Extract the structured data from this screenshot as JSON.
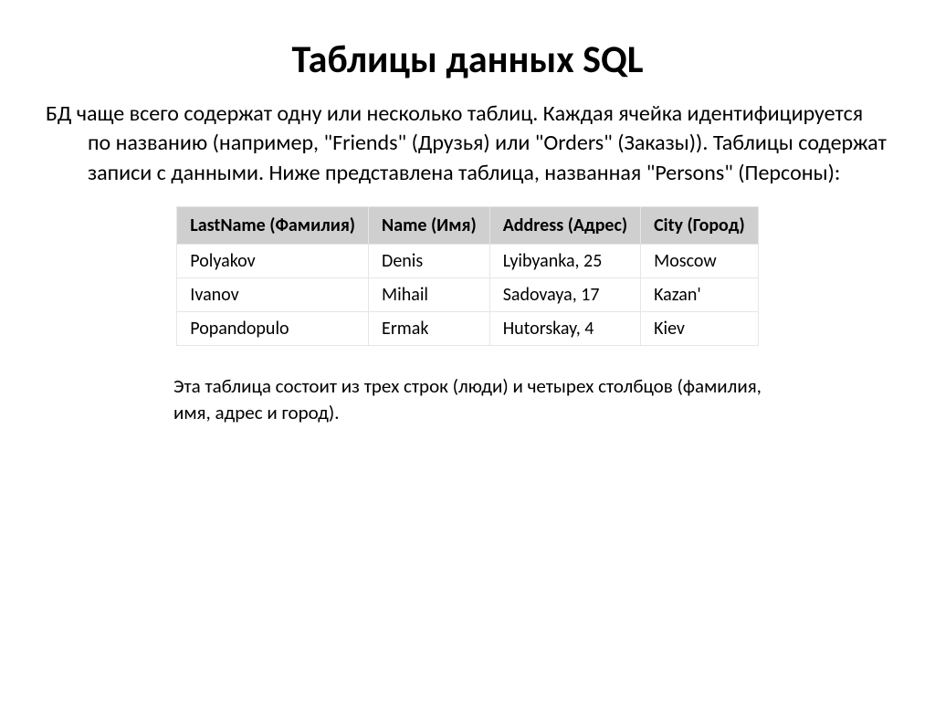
{
  "title": "Таблицы данных SQL",
  "paragraph": "БД чаще всего содержат одну или несколько таблиц. Каждая ячейка идентифицируется по названию (например, \"Friends\" (Друзья) или \"Orders\" (Заказы)). Таблицы содержат записи с данными. Ниже представлена таблица, названная \"Persons\" (Персоны):",
  "table": {
    "headers": [
      "LastName (Фамилия)",
      "Name (Имя)",
      "Address (Адрес)",
      "City (Город)"
    ],
    "rows": [
      [
        "Polyakov",
        "Denis",
        "Lyibyanka, 25",
        "Moscow"
      ],
      [
        "Ivanov",
        "Mihail",
        "Sadovaya, 17",
        "Kazan'"
      ],
      [
        "Popandopulo",
        "Ermak",
        "Hutorskay, 4",
        "Kiev"
      ]
    ]
  },
  "footnote": "Эта таблица состоит из трех строк (люди) и четырех столбцов (фамилия, имя, адрес и город)."
}
